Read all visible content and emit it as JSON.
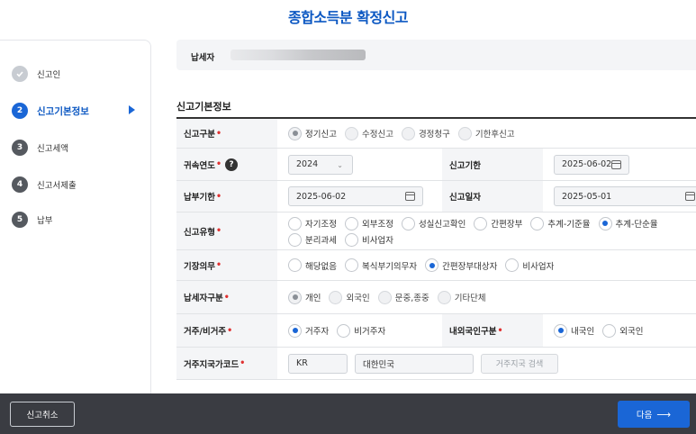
{
  "title": "종합소득분 확정신고",
  "steps": [
    {
      "num": "",
      "label": "신고인",
      "state": "done"
    },
    {
      "num": "2",
      "label": "신고기본정보",
      "state": "active"
    },
    {
      "num": "3",
      "label": "신고세액",
      "state": "todo"
    },
    {
      "num": "4",
      "label": "신고서제출",
      "state": "todo"
    },
    {
      "num": "5",
      "label": "납부",
      "state": "todo"
    }
  ],
  "taxpayer": {
    "label": "납세자"
  },
  "section_title": "신고기본정보",
  "form": {
    "report_type": {
      "label": "신고구분",
      "options": [
        "정기신고",
        "수정신고",
        "경정청구",
        "기한후신고"
      ],
      "selected": "정기신고"
    },
    "belong_year": {
      "label": "귀속연도",
      "value": "2024",
      "help": "?"
    },
    "report_deadline": {
      "label": "신고기한",
      "value": "2025-06-02"
    },
    "pay_deadline": {
      "label": "납부기한",
      "value": "2025-06-02"
    },
    "report_date": {
      "label": "신고일자",
      "value": "2025-05-01"
    },
    "report_kind": {
      "label": "신고유형",
      "options": [
        "자기조정",
        "외부조정",
        "성실신고확인",
        "간편장부",
        "추계-기준율",
        "추계-단순율",
        "분리과세",
        "비사업자"
      ],
      "selected": "추계-단순율"
    },
    "bookkeeping": {
      "label": "기장의무",
      "options": [
        "해당없음",
        "복식부기의무자",
        "간편장부대상자",
        "비사업자"
      ],
      "selected": "간편장부대상자"
    },
    "taxpayer_type": {
      "label": "납세자구분",
      "options": [
        "개인",
        "외국인",
        "문중,종중",
        "기타단체"
      ],
      "selected": "개인"
    },
    "residency": {
      "label": "거주/비거주",
      "options": [
        "거주자",
        "비거주자"
      ],
      "selected": "거주자"
    },
    "nationality": {
      "label": "내외국인구분",
      "options": [
        "내국인",
        "외국인"
      ],
      "selected": "내국인"
    },
    "country_code": {
      "label": "거주지국가코드",
      "code": "KR",
      "name": "대한민국",
      "search_label": "거주지국 검색"
    }
  },
  "footer": {
    "cancel_label": "신고취소",
    "next_label": "다음",
    "next_arrow": "⟶"
  }
}
